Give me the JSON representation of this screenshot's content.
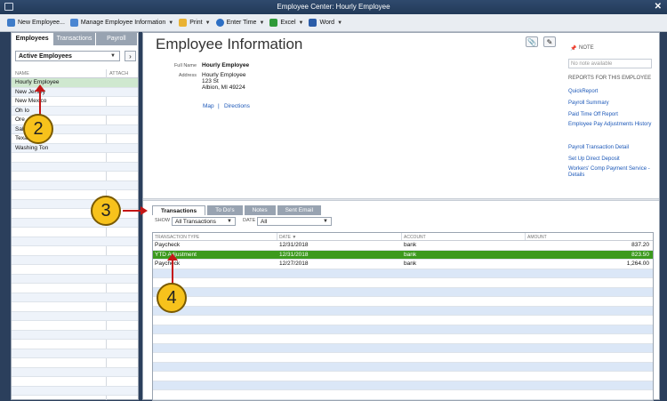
{
  "window": {
    "title": "Employee Center: Hourly Employee"
  },
  "toolbar": {
    "items": [
      {
        "label": "New Employee...",
        "icon": "new-employee-icon",
        "caret": false
      },
      {
        "label": "Manage Employee Information",
        "icon": "manage-info-icon",
        "caret": true
      },
      {
        "label": "Print",
        "icon": "print-icon",
        "caret": true
      },
      {
        "label": "Enter Time",
        "icon": "clock-icon",
        "caret": true
      },
      {
        "label": "Excel",
        "icon": "excel-icon",
        "caret": true
      },
      {
        "label": "Word",
        "icon": "word-icon",
        "caret": true
      }
    ]
  },
  "sidebar": {
    "tabs": [
      "Employees",
      "Transactions",
      "Payroll"
    ],
    "filter": "Active Employees",
    "columns": {
      "name": "NAME",
      "attach": "ATTACH"
    },
    "employees": [
      "Hourly Employee",
      "New Jersey",
      "New Mexico",
      "Oh Io",
      "Ore",
      "Sal",
      "Texas",
      "Washing Ton"
    ]
  },
  "main": {
    "title": "Employee Information",
    "full_name_label": "Full Name",
    "full_name": "Hourly Employee",
    "address_label": "Address",
    "address": [
      "Hourly Employee",
      "123 St",
      "Albion, MI 49224"
    ],
    "map_link": "Map",
    "separator": "|",
    "directions_link": "Directions",
    "note_title": "NOTE",
    "note_placeholder": "No note available",
    "reports_title": "REPORTS FOR THIS EMPLOYEE",
    "reports": [
      "QuickReport",
      "Payroll Summary",
      "Paid Time Off Report",
      "Employee Pay Adjustments History",
      "Payroll Transaction Detail",
      "Set Up Direct Deposit",
      "Workers' Comp Payment Service - Details"
    ]
  },
  "transactions": {
    "tabs": [
      "Transactions",
      "To Do's",
      "Notes",
      "Sent Email"
    ],
    "show_label": "SHOW",
    "show_value": "All Transactions",
    "date_label": "DATE",
    "date_value": "All",
    "columns": [
      "TRANSACTION TYPE",
      "DATE ▼",
      "ACCOUNT",
      "AMOUNT"
    ],
    "rows": [
      {
        "type": "Paycheck",
        "date": "12/31/2018",
        "account": "bank",
        "amount": "837.20"
      },
      {
        "type": "YTD Adjustment",
        "date": "12/31/2018",
        "account": "bank",
        "amount": "823.50"
      },
      {
        "type": "Paycheck",
        "date": "12/27/2018",
        "account": "bank",
        "amount": "1,264.00"
      }
    ]
  },
  "callouts": [
    "2",
    "3",
    "4"
  ],
  "colors": {
    "selected_row": "#3c9a1e",
    "link": "#1c58b8",
    "callout": "#f7c21c",
    "arrow": "#c41616"
  }
}
